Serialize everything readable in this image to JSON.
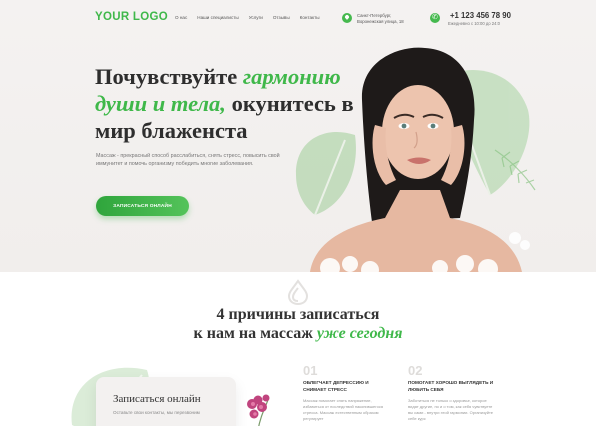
{
  "header": {
    "logo": "YOUR LOGO",
    "nav": [
      "О нас",
      "Наши специалисты",
      "Услуги",
      "Отзывы",
      "Контакты"
    ],
    "address_line1": "Санкт-Петербург,",
    "address_line2": "Воронежская улица, 18",
    "phone": "+1 123 456 78 90",
    "hours": "Ежедневно с 10:00 до 24:0"
  },
  "hero": {
    "title_part1": "Почувствуйте ",
    "title_accent1": "гармонию души и тела,",
    "title_part2": " окунитесь в мир блаженста",
    "lead": "Массаж - прекрасный способ расслабиться, снять стресс, повысить свой иммунитет и помочь организму победить многие заболевания.",
    "cta": "ЗАПИСАТЬСЯ ОНЛАЙН"
  },
  "reasons": {
    "title_line1": "4 причины записаться",
    "title_line2_plain": "к нам на массаж ",
    "title_line2_accent": "уже сегодня",
    "card_title": "Записаться онлайн",
    "card_sub": "Оставьте свои контакты, мы перезвоним",
    "items": [
      {
        "num": "01",
        "title": "ОБЛЕГЧАЕТ ДЕПРЕССИЮ И СНИМАЕТ СТРЕСС",
        "text": "Массаж помогает снять напряжение, избавиться от последствий накопившегося стресса. Массаж естественным образом регулирует"
      },
      {
        "num": "02",
        "title": "ПОМОГАЕТ ХОРОШО ВЫГЛЯДЕТЬ И ЛЮБИТЬ СЕБЯ",
        "text": "Заботиться не только о здоровье, которое видят другие, но и о том, как себя чувствуете вы сами - внутри этой гармонии. Организуйте себе курс"
      }
    ]
  },
  "colors": {
    "accent": "#3fb84a",
    "text": "#2e2e2e",
    "muted": "#777777"
  }
}
